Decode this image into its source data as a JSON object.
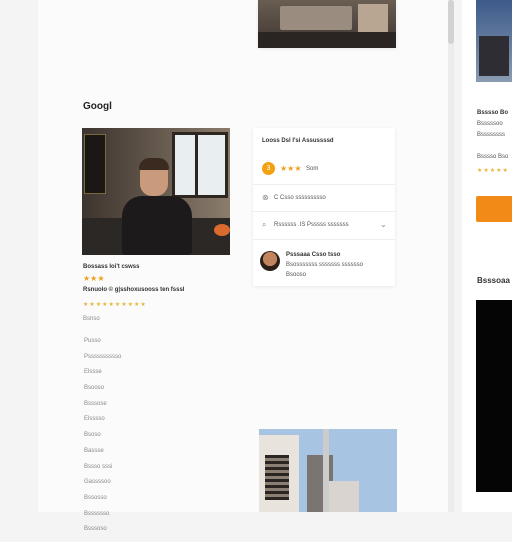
{
  "page": {
    "section_title": "Googl"
  },
  "profile_card": {
    "name": "Bossass Ioi't cswss",
    "rating_stars": "★★★",
    "rating_value": 3,
    "subtitle": "Rsnuolo ©  g|sshoxusooss  ten fsssl",
    "review_stars": "★★★★★★★★★★",
    "label": "Bsnso"
  },
  "filters": [
    "Pusso",
    "Psssssssssso",
    "Elssse",
    "Bsooso",
    "Bsssose",
    "Elsssso",
    "Bsoso",
    "Bassse",
    "Bssso   sssi",
    "Gassssoo",
    "Bssosso",
    "Bsssssso",
    "Bsssoso"
  ],
  "info_card": {
    "title": "Looss Dsl I'si  Assussssd",
    "rating_badge": "3",
    "rating_stars": "★★★",
    "rating_label": "Som",
    "option_1": "C Csso ssssssssso",
    "option_2": "Rssssss .IS  Psssss sssssss",
    "reviewer_name": "Psssaaa  Csso tsso",
    "review_line_1": "Bsosssssss sssssss sssssso",
    "review_line_2": "Bsooso"
  },
  "right_panel": {
    "line_1": "Bsssso Bo",
    "line_2": "Bsssssoo",
    "line_3": "Bssssssss",
    "line_4": "Bsssso Bso",
    "stars": "★★★★★",
    "heading": "Bsssoaa"
  },
  "colors": {
    "accent": "#f28a17",
    "star": "#f0a01e"
  },
  "icons": {
    "close": "close-icon",
    "search": "search-icon",
    "chevron": "chevron-down-icon"
  }
}
